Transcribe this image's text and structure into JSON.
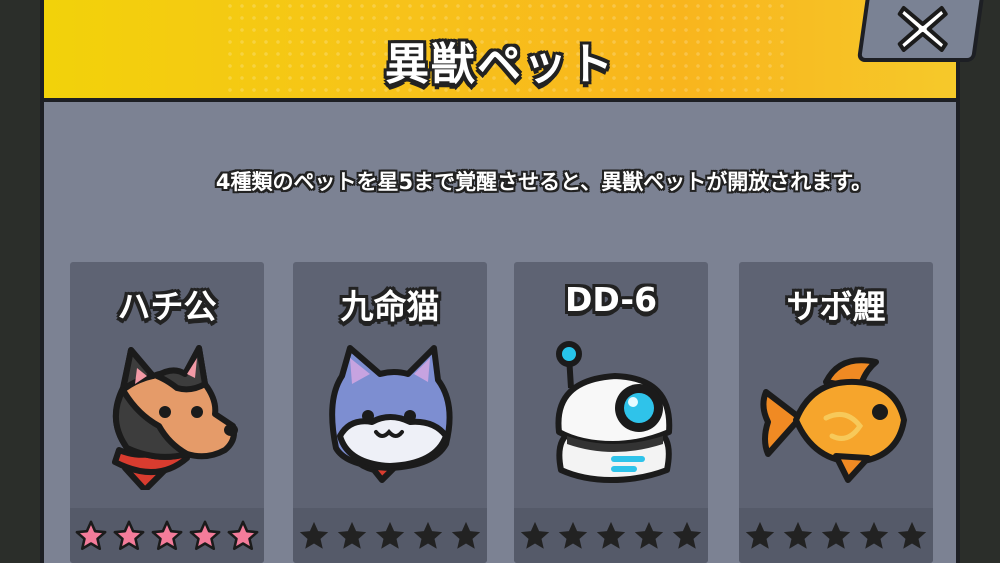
{
  "dialog": {
    "title": "異獣ペット",
    "description": "4種類のペットを星5まで覚醒させると、異獣ペットが開放されます。"
  },
  "pets": [
    {
      "name": "ハチ公",
      "icon": "shiba-dog-icon",
      "stars": 5,
      "max_stars": 5
    },
    {
      "name": "九命猫",
      "icon": "blue-cat-icon",
      "stars": 0,
      "max_stars": 5
    },
    {
      "name": "DD-6",
      "icon": "white-robot-icon",
      "stars": 0,
      "max_stars": 5
    },
    {
      "name": "サボ鯉",
      "icon": "goldfish-icon",
      "stars": 0,
      "max_stars": 5
    }
  ],
  "colors": {
    "header": "#f8c01d",
    "panel": "#7c8293",
    "card": "#5e6373",
    "star_filled": "#f47c9a",
    "star_empty": "#222222"
  }
}
